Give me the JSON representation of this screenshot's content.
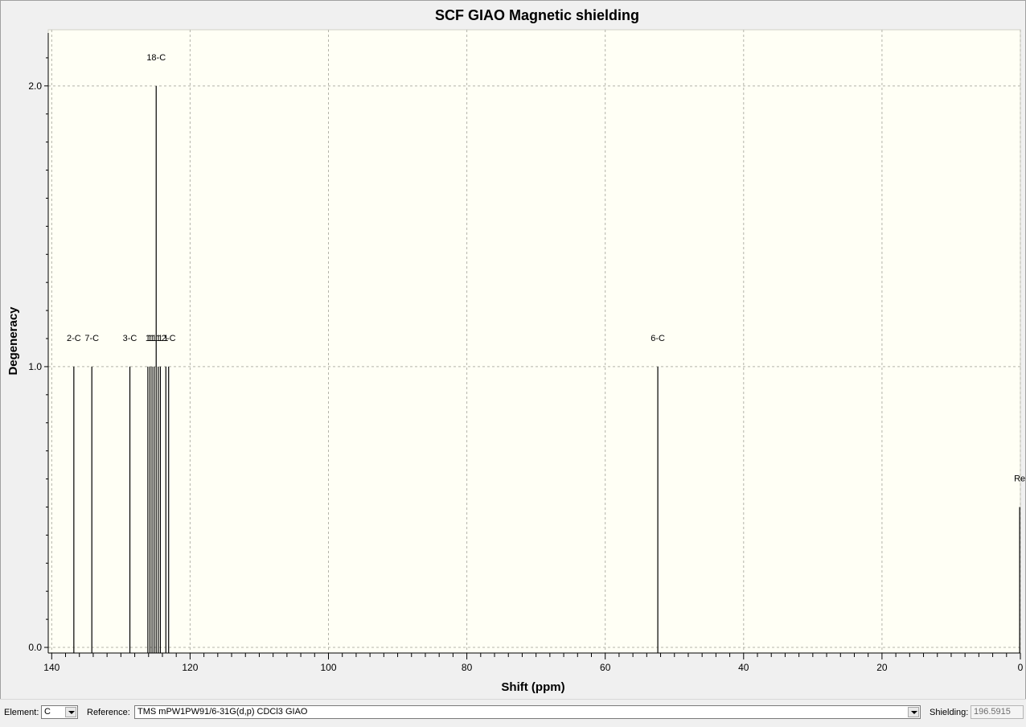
{
  "chart_data": {
    "type": "bar",
    "title": "SCF GIAO Magnetic shielding",
    "xlabel": "Shift (ppm)",
    "ylabel": "Degeneracy",
    "xlim": [
      140.5,
      0
    ],
    "ylim": [
      -0.02,
      2.2
    ],
    "xticks": [
      140,
      120,
      100,
      80,
      60,
      40,
      20,
      0
    ],
    "yticks": [
      0.0,
      1.0,
      2.0
    ],
    "ytick_labels": [
      "0.0",
      "1.0",
      "2.0"
    ],
    "grid": true,
    "peaks": [
      {
        "x": 136.8,
        "y": 1,
        "label": "2-C"
      },
      {
        "x": 134.2,
        "y": 1,
        "label": "7-C"
      },
      {
        "x": 128.7,
        "y": 1,
        "label": "3-C"
      },
      {
        "x": 126.1,
        "y": 1,
        "label": "1"
      },
      {
        "x": 125.8,
        "y": 1,
        "label": "1"
      },
      {
        "x": 125.5,
        "y": 1,
        "label": "1"
      },
      {
        "x": 125.2,
        "y": 1,
        "label": "1"
      },
      {
        "x": 124.9,
        "y": 2,
        "label": "18-C"
      },
      {
        "x": 124.6,
        "y": 1,
        "label": "1"
      },
      {
        "x": 124.3,
        "y": 1,
        "label": "1"
      },
      {
        "x": 123.5,
        "y": 1,
        "label": "1"
      },
      {
        "x": 123.1,
        "y": 1,
        "label": "2-C"
      },
      {
        "x": 52.4,
        "y": 1,
        "label": "6-C"
      },
      {
        "x": 0.1,
        "y": 0.5,
        "label": "Re"
      }
    ]
  },
  "controls": {
    "element_label": "Element:",
    "element_value": "C",
    "reference_label": "Reference:",
    "reference_value": "TMS mPW1PW91/6-31G(d,p) CDCl3 GIAO",
    "shielding_label": "Shielding:",
    "shielding_value": "196.5915"
  },
  "colors": {
    "plot_background": "#fffff5",
    "grid": "#b4b4aa",
    "peak": "#000000"
  }
}
